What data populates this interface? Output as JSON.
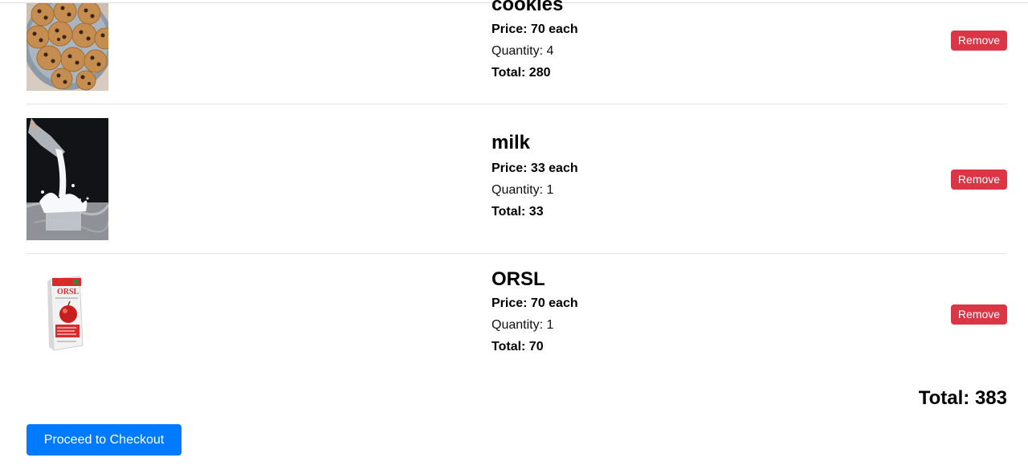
{
  "cart": {
    "items": [
      {
        "name": "cookies",
        "price_text": "Price: 70 each",
        "quantity_text": "Quantity: 4",
        "total_text": "Total: 280",
        "remove_label": "Remove"
      },
      {
        "name": "milk",
        "price_text": "Price: 33 each",
        "quantity_text": "Quantity: 1",
        "total_text": "Total: 33",
        "remove_label": "Remove"
      },
      {
        "name": "ORSL",
        "price_text": "Price: 70 each",
        "quantity_text": "Quantity: 1",
        "total_text": "Total: 70",
        "remove_label": "Remove"
      }
    ],
    "grand_total_text": "Total: 383",
    "checkout_label": "Proceed to Checkout",
    "product_image_text": {
      "orsl_brand": "ORSL"
    }
  },
  "colors": {
    "remove_button": "#dc3545",
    "checkout_button": "#007bff",
    "divider": "#e6e6e6"
  }
}
